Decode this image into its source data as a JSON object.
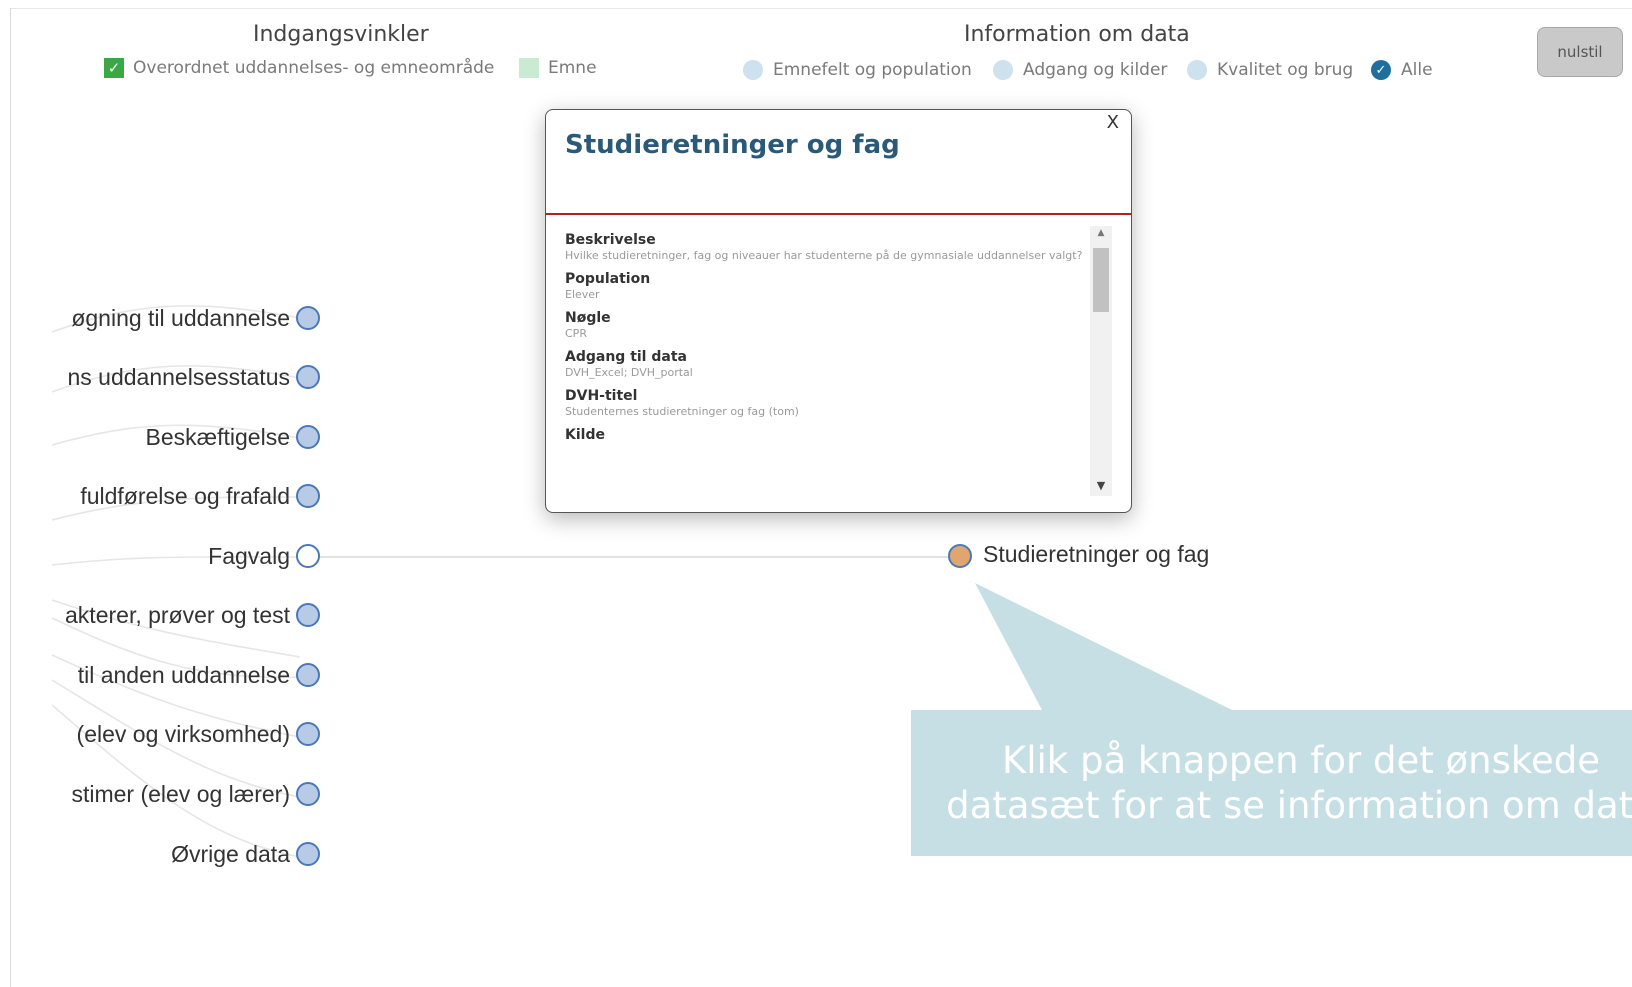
{
  "legend": {
    "entry_title": "Indgangsvinkler",
    "entry_items": [
      {
        "label": "Overordnet uddannelses- og emneområde",
        "checked": true
      },
      {
        "label": "Emne",
        "checked": false
      }
    ],
    "info_title": "Information om data",
    "info_items": [
      {
        "label": "Emnefelt og population",
        "checked": false
      },
      {
        "label": "Adgang og kilder",
        "checked": false
      },
      {
        "label": "Kvalitet og brug",
        "checked": false
      },
      {
        "label": "Alle",
        "checked": true
      }
    ],
    "check_glyph": "✓"
  },
  "reset_button": "nulstil",
  "tree": {
    "nodes": [
      "øgning til uddannelse",
      "ns uddannelsesstatus",
      "Beskæftigelse",
      "fuldførelse og frafald",
      "Fagvalg",
      "akterer, prøver og test",
      "til anden uddannelse",
      "(elev og virksomhed)",
      "stimer (elev og lærer)",
      "Øvrige data"
    ],
    "selected_node": "Fagvalg",
    "target_node": "Studieretninger og fag"
  },
  "popup": {
    "close_label": "X",
    "title": "Studieretninger og fag",
    "fields": [
      {
        "label": "Beskrivelse",
        "value": "Hvilke studieretninger, fag og niveauer har studenterne på de gymnasiale uddannelser valgt?"
      },
      {
        "label": "Population",
        "value": "Elever"
      },
      {
        "label": "Nøgle",
        "value": "CPR"
      },
      {
        "label": "Adgang til data",
        "value": "DVH_Excel; DVH_portal"
      },
      {
        "label": "DVH-titel",
        "value": "Studenternes studieretninger og fag (tom)"
      },
      {
        "label": "Kilde",
        "value": ""
      }
    ]
  },
  "tooltip": {
    "line1": "Klik på knappen for det ønskede",
    "line2": "datasæt for at se information om data"
  },
  "colors": {
    "check_on": "#39a845",
    "check_off": "#c8ebd2",
    "info_dot_off": "#cde1ee",
    "info_dot_on": "#1f6f9c",
    "popup_title": "#2b5a78",
    "popup_separator": "#b21f24",
    "node_fill": "#b8cbe6",
    "node_stroke": "#4a78b8",
    "target_fill": "#e1a66e",
    "tooltip_bg": "#c5dfe5"
  }
}
